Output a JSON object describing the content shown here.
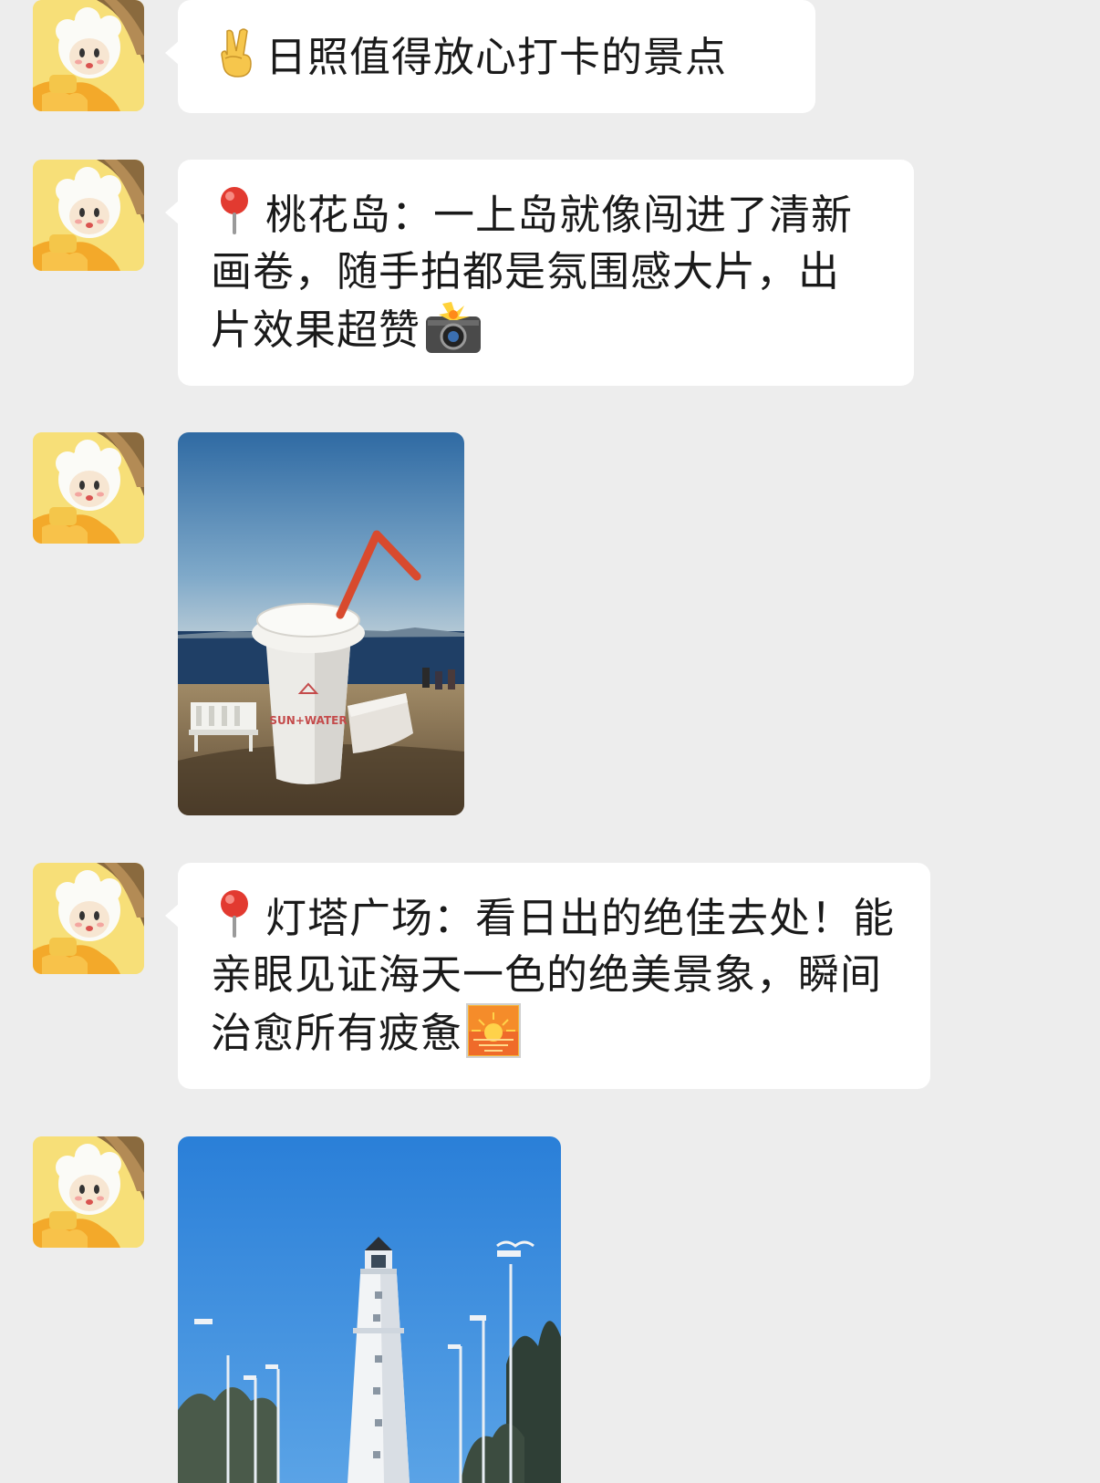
{
  "messages": [
    {
      "type": "text",
      "icon": "victory-hand-emoji",
      "text": "日照值得放心打卡的景点"
    },
    {
      "type": "text",
      "icon": "round-pushpin-emoji",
      "text": "桃花岛：一上岛就像闯进了清新画卷，随手拍都是氛围感大片，出片效果超赞",
      "trailing_icon": "camera-flash-emoji"
    },
    {
      "type": "image",
      "image_label": "SUN+WATER"
    },
    {
      "type": "text",
      "icon": "round-pushpin-emoji",
      "text": "灯塔广场：看日出的绝佳去处！能亲眼见证海天一色的绝美景象，瞬间治愈所有疲惫",
      "trailing_icon": "sunrise-emoji"
    },
    {
      "type": "image"
    }
  ],
  "colors": {
    "background": "#ededed",
    "bubble": "#ffffff",
    "text": "#1a1a1a"
  }
}
